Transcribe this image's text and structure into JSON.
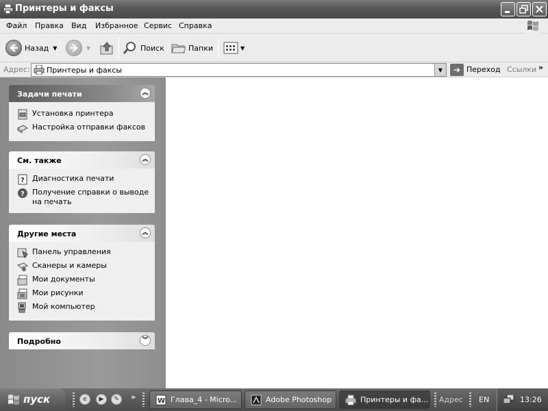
{
  "window": {
    "title": "Принтеры и факсы",
    "controls": [
      "minimize",
      "restore",
      "close"
    ]
  },
  "menu": [
    "Файл",
    "Правка",
    "Вид",
    "Избранное",
    "Сервис",
    "Справка"
  ],
  "toolbar": {
    "back_label": "Назад",
    "search_label": "Поиск",
    "folders_label": "Папки"
  },
  "address": {
    "label": "Адрес:",
    "value": "Принтеры и факсы",
    "go_label": "Переход",
    "links_label": "Ссылки",
    "links_chevron": "»"
  },
  "taskpane": {
    "panels": [
      {
        "title": "Задачи печати",
        "items": [
          "Установка принтера",
          "Настройка отправки факсов"
        ]
      },
      {
        "title": "См. также",
        "items": [
          "Диагностика печати",
          "Получение справки о выводе на печать"
        ]
      },
      {
        "title": "Другие места",
        "items": [
          "Панель управления",
          "Сканеры и камеры",
          "Мои документы",
          "Мои рисунки",
          "Мой компьютер"
        ]
      },
      {
        "title": "Подробно",
        "items": []
      }
    ]
  },
  "taskbar": {
    "start_label": "пуск",
    "buttons": [
      {
        "label": "Глава_4 - Micro..."
      },
      {
        "label": "Adobe Photoshop"
      },
      {
        "label": "Принтеры и фа..."
      }
    ],
    "address_label": "Адрес",
    "language": "EN",
    "clock": "13:26",
    "chevron": "»"
  }
}
